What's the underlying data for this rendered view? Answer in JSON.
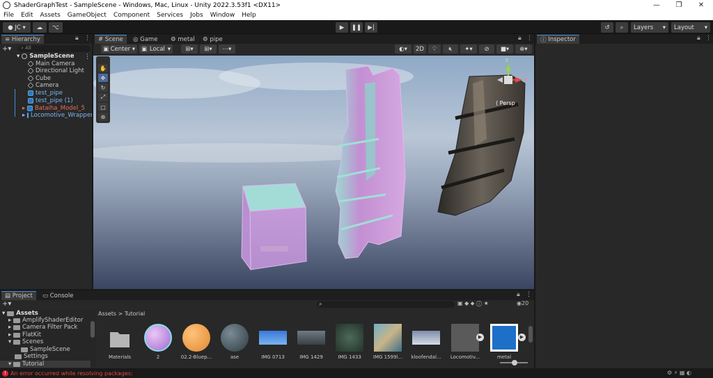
{
  "window": {
    "title": "ShaderGraphTest - SampleScene - Windows, Mac, Linux - Unity 2022.3.53f1 <DX11>",
    "minimize": "—",
    "maximize": "❐",
    "close": "✕"
  },
  "menu": [
    "File",
    "Edit",
    "Assets",
    "GameObject",
    "Component",
    "Services",
    "Jobs",
    "Window",
    "Help"
  ],
  "toolbar": {
    "account": "JC",
    "layers": "Layers",
    "layout": "Layout"
  },
  "hierarchy": {
    "tab": "Hierarchy",
    "search_placeholder": "All",
    "scene": "SampleScene",
    "items": [
      "Main Camera",
      "Directional Light",
      "Cube",
      "Camera",
      "test_pipe",
      "test_pipe (1)",
      "Bataiha_Model_5",
      "Locomotive_Wrapper"
    ]
  },
  "scene_tabs": [
    "Scene",
    "Game",
    "metal",
    "pipe"
  ],
  "scene_toolbar": {
    "pivot": "Center",
    "space": "Local",
    "mode2d": "2D"
  },
  "gizmo": {
    "label": "Persp",
    "y": "y",
    "x": "x"
  },
  "inspector": {
    "tab": "Inspector"
  },
  "project": {
    "tabs": [
      "Project",
      "Console"
    ],
    "breadcrumb_root": "Assets",
    "breadcrumb_sep": ">",
    "breadcrumb_leaf": "Tutorial",
    "hidden_count": "20",
    "tree": [
      "Assets",
      "AmplifyShaderEditor",
      "Camera Filter Pack",
      "FlatKit",
      "Scenes",
      "SampleScene",
      "Settings",
      "Tutorial"
    ],
    "assets": [
      "Materials",
      "2",
      "02.2-Bluep...",
      "ase",
      "IMG 0713",
      "IMG 1429",
      "IMG 1433",
      "IMG 1599l...",
      "kloofendal...",
      "Locomotiv...",
      "metal"
    ]
  },
  "status": {
    "error": "An error occurred while resolving packages:"
  }
}
